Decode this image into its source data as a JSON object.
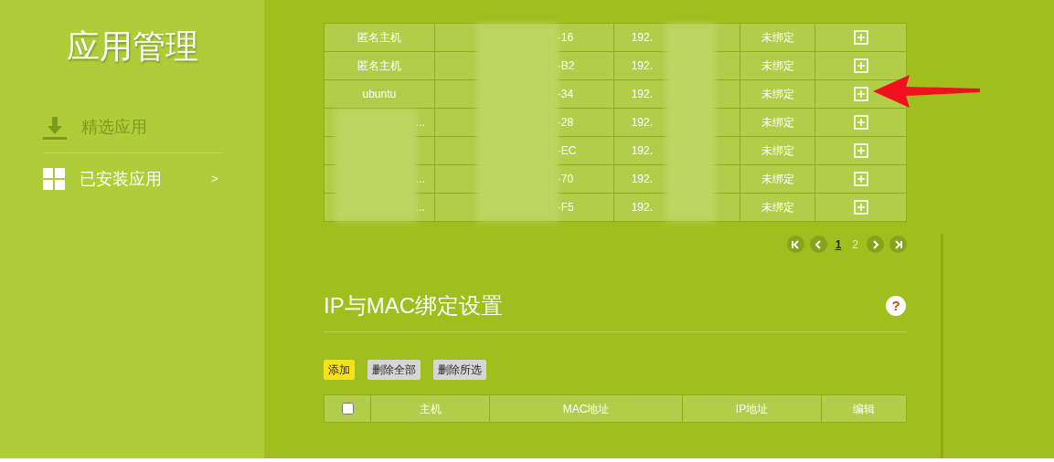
{
  "sidebar": {
    "title": "应用管理",
    "items": [
      {
        "label": "精选应用",
        "kind": "download",
        "selected": false
      },
      {
        "label": "已安装应用",
        "kind": "grid",
        "selected": true,
        "chevron": ">"
      }
    ]
  },
  "device_table": {
    "rows": [
      {
        "host": "匿名主机",
        "mac": "-16",
        "ip": "192.",
        "status": "未绑定"
      },
      {
        "host": "匿名主机",
        "mac": "-B2",
        "ip": "192.",
        "status": "未绑定"
      },
      {
        "host": "ubuntu",
        "mac": "-34",
        "ip": "192.",
        "status": "未绑定"
      },
      {
        "host": "...",
        "mac": "-28",
        "ip": "192.",
        "status": "未绑定"
      },
      {
        "mac": "-EC",
        "ip": "192.",
        "status": "未绑定"
      },
      {
        "host": "...",
        "mac": "-70",
        "ip": "192.",
        "status": "未绑定"
      },
      {
        "host": "...",
        "mac": "-F5",
        "ip": "192.",
        "status": "未绑定"
      }
    ]
  },
  "pagination": {
    "pages": [
      {
        "label": "1",
        "selected": true
      },
      {
        "label": "2",
        "selected": false
      }
    ]
  },
  "binding_section": {
    "title": "IP与MAC绑定设置",
    "help": "?",
    "buttons": [
      {
        "label": "添加",
        "kind": "primary"
      },
      {
        "label": "删除全部",
        "kind": "secondary"
      },
      {
        "label": "删除所选",
        "kind": "secondary"
      }
    ],
    "table": {
      "select_all": {
        "checked": false
      },
      "columns": [
        "主机",
        "MAC地址",
        "IP地址",
        "编辑"
      ]
    }
  }
}
